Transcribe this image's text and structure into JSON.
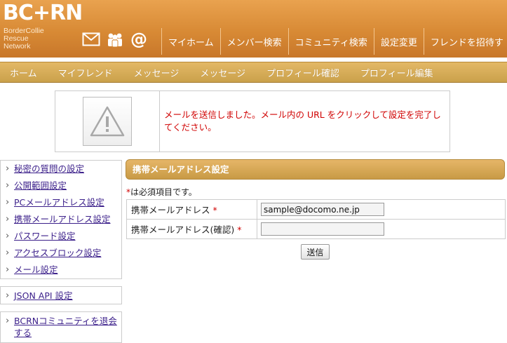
{
  "logo": {
    "main": "BC",
    "plus": "+",
    "main_end": "RN",
    "sub_lines": [
      "BorderCollie",
      "Rescue",
      "Network"
    ]
  },
  "header_icons": [
    "envelope-icon",
    "people-icon",
    "at-sign-icon"
  ],
  "top_nav": [
    "マイホーム",
    "メンバー検索",
    "コミュニティ検索",
    "設定変更",
    "フレンドを招待す"
  ],
  "sub_nav": [
    "ホーム",
    "マイフレンド",
    "メッセージ",
    "メッセージ",
    "プロフィール確認",
    "プロフィール編集"
  ],
  "message": {
    "text": "メールを送信しました。メール内の URL をクリックして設定を完了してください。"
  },
  "sidebar": {
    "group1": [
      "秘密の質問の設定",
      "公開範囲設定",
      "PCメールアドレス設定",
      "携帯メールアドレス設定",
      "パスワード設定",
      "アクセスブロック設定",
      "メール設定"
    ],
    "group2": [
      "JSON API 設定"
    ],
    "group3": [
      "BCRNコミュニティを退会する"
    ]
  },
  "form": {
    "title": "携帯メールアドレス設定",
    "required_star": "*",
    "required_note": "は必須項目です。",
    "rows": [
      {
        "label": "携帯メールアドレス",
        "value": "sample@docomo.ne.jp"
      },
      {
        "label": "携帯メールアドレス(確認)",
        "value": ""
      }
    ],
    "submit_label": "送信"
  },
  "colors": {
    "header": "#d88a35",
    "subnav": "#caa14b",
    "alert_text": "#d00000",
    "link": "#3b1f8a"
  }
}
